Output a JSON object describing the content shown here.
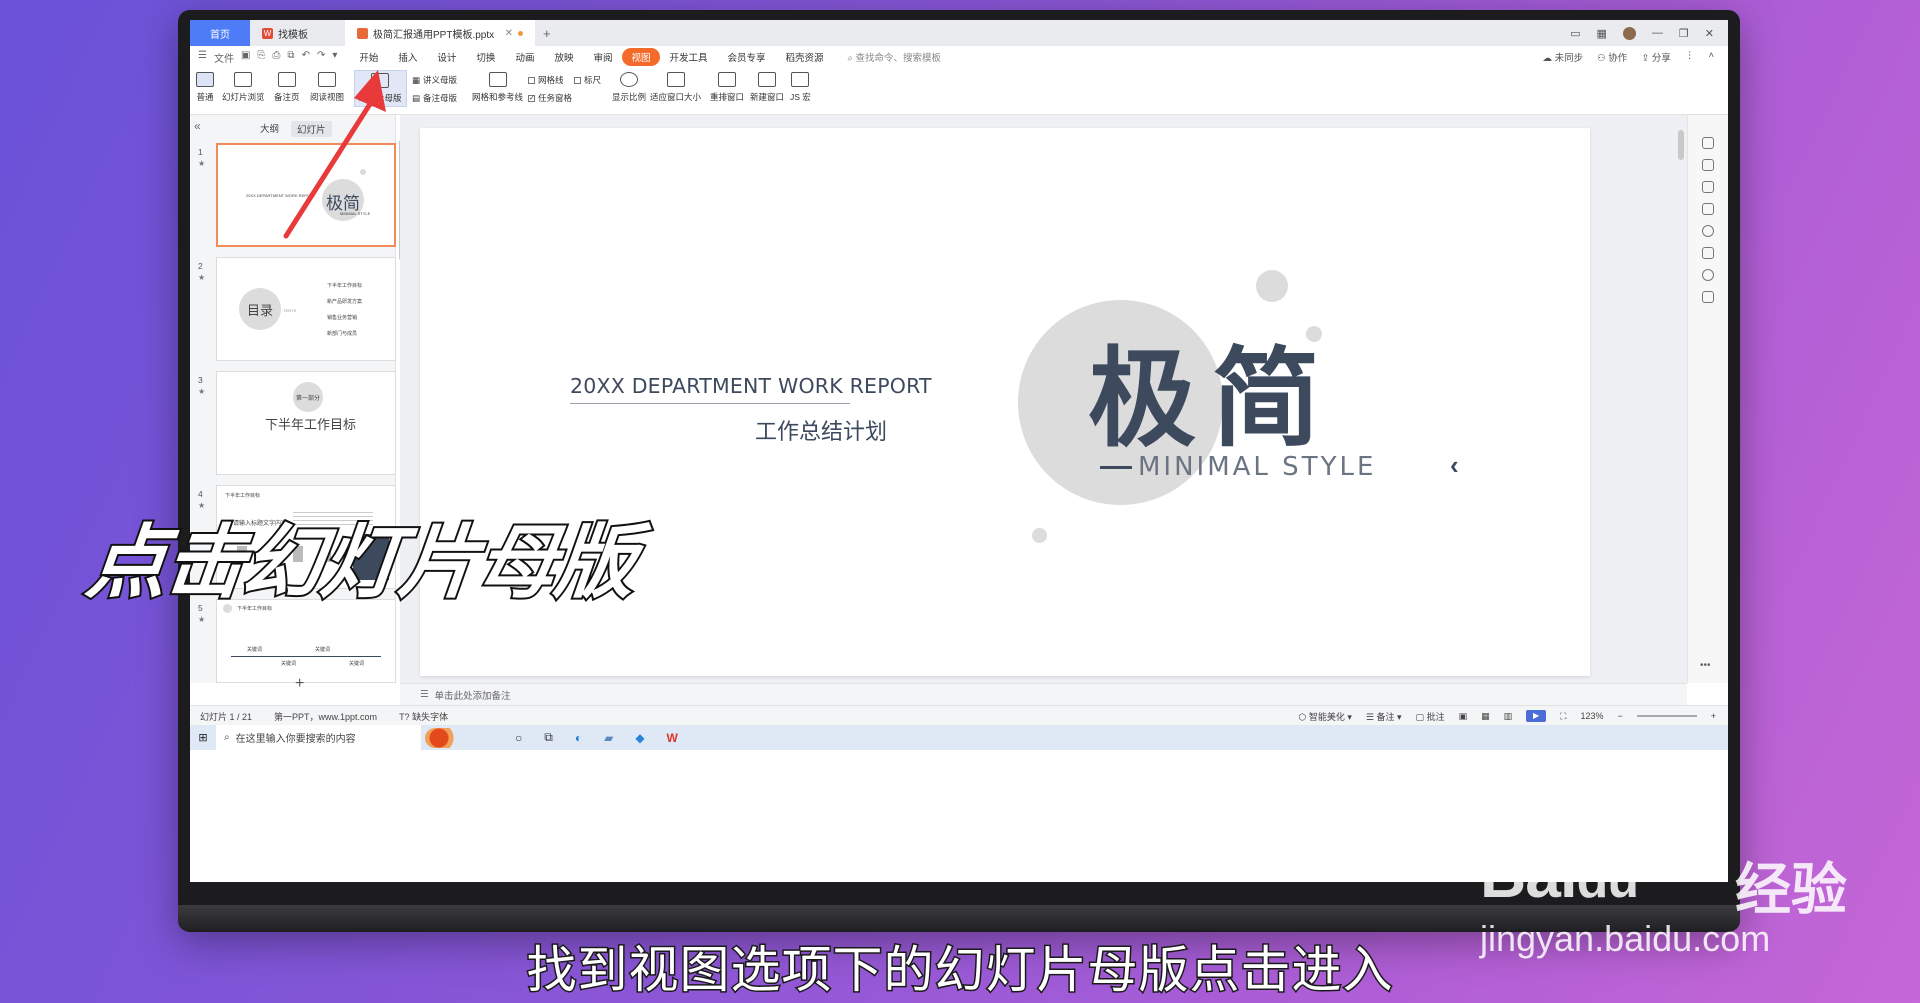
{
  "tabs": {
    "home": "首页",
    "templates": "找模板",
    "document": "极简汇报通用PPT模板.pptx"
  },
  "menu": {
    "file": "文件",
    "items": [
      "开始",
      "插入",
      "设计",
      "切换",
      "动画",
      "放映",
      "审阅",
      "视图",
      "开发工具",
      "会员专享",
      "稻壳资源"
    ],
    "active": "视图",
    "search": "查找命令、搜索模板",
    "right": [
      "未同步",
      "协作",
      "分享"
    ]
  },
  "ribbon": {
    "normal": "普通",
    "slide_sorter": "幻灯片浏览",
    "notes_page": "备注页",
    "reading_view": "阅读视图",
    "slide_master": "幻灯片母版",
    "handout_master": "讲义母版",
    "notes_master": "备注母版",
    "grid_guides": "网格和参考线",
    "gridlines": "网格线",
    "ruler": "标尺",
    "task_pane": "任务窗格",
    "zoom": "显示比例",
    "fit_window": "适应窗口大小",
    "arrange": "重排窗口",
    "new_window": "新建窗口",
    "macro": "JS 宏"
  },
  "left_panel": {
    "tab_outline": "大纲",
    "tab_slides": "幻灯片"
  },
  "thumbs": {
    "t1_title": "极简",
    "t1_sub": "20XX DEPARTMENT WORK REPORT",
    "t1_style": "MINIMAL STYLE",
    "t2_title": "目录",
    "t2_contents": "TENTS",
    "t2_items": [
      "下半年工作目标",
      "新产品研发方案",
      "销售业务营销",
      "新部门与成员"
    ],
    "t3_part": "第一部分",
    "t3_title": "下半年工作目标",
    "t4_title": "下半年工作目标",
    "t4_sub": "请输入标题文字内容",
    "t5_title": "下半年工作目标",
    "t5_labels": [
      "关键词",
      "关键词",
      "关键词",
      "关键词"
    ]
  },
  "slide": {
    "report": "20XX DEPARTMENT WORK REPORT",
    "plan": "工作总结计划",
    "title_a": "极",
    "title_b": "简",
    "style": "MINIMAL STYLE"
  },
  "notes_placeholder": "单击此处添加备注",
  "status": {
    "slide_count": "幻灯片 1 / 21",
    "theme": "第一PPT，www.1ppt.com",
    "missing_font": "缺失字体",
    "beautify": "智能美化",
    "notes": "备注",
    "comments": "批注",
    "zoom": "123%"
  },
  "taskbar": {
    "search": "在这里输入你要搜索的内容"
  },
  "overlay": {
    "big": "点击幻灯片母版",
    "bottom": "找到视图选项下的幻灯片母版点击进入",
    "wm_latin": "Bai",
    "wm_du": "du",
    "wm_cn": "经验",
    "wm_url": "jingyan.baidu.com"
  },
  "colors": {
    "active_tab": "#f46a2a",
    "home_tab": "#4e7cf6",
    "title_dark": "#3d4a5e",
    "circle": "#dcdcdc",
    "arrow": "#e83a3a"
  }
}
